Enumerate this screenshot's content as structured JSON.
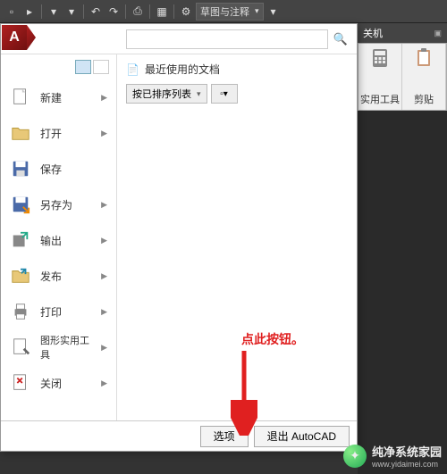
{
  "toolbar": {
    "workspace_label": "草图与注释"
  },
  "ribbon": {
    "tab": "关机",
    "panels": [
      {
        "label": "实用工具"
      },
      {
        "label": "剪贴"
      }
    ]
  },
  "app_menu": {
    "logo": "A",
    "search_placeholder": "",
    "recent_title": "最近使用的文档",
    "sort_label": "按已排序列表",
    "items": [
      {
        "label": "新建",
        "has_arrow": true,
        "icon": "file-new"
      },
      {
        "label": "打开",
        "has_arrow": true,
        "icon": "folder-open"
      },
      {
        "label": "保存",
        "has_arrow": false,
        "icon": "save"
      },
      {
        "label": "另存为",
        "has_arrow": true,
        "icon": "save-as"
      },
      {
        "label": "输出",
        "has_arrow": true,
        "icon": "export"
      },
      {
        "label": "发布",
        "has_arrow": true,
        "icon": "publish"
      },
      {
        "label": "打印",
        "has_arrow": true,
        "icon": "print"
      },
      {
        "label": "图形实用工具",
        "has_arrow": true,
        "icon": "tools"
      },
      {
        "label": "关闭",
        "has_arrow": true,
        "icon": "close"
      }
    ],
    "footer": {
      "options": "选项",
      "exit": "退出 AutoCAD"
    }
  },
  "annotation": {
    "text": "点此按钮。"
  },
  "watermark": {
    "title": "纯净系统家园",
    "url": "www.yidaimei.com"
  }
}
